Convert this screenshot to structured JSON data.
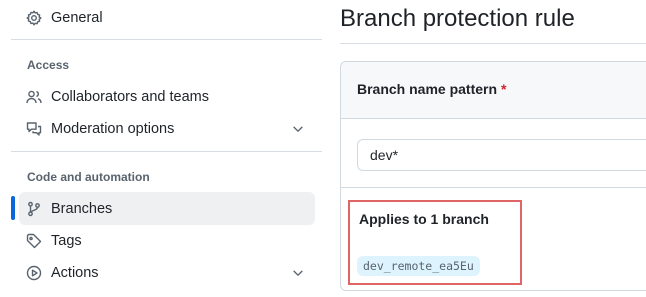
{
  "sidebar": {
    "general_label": "General",
    "access_heading": "Access",
    "collaborators_label": "Collaborators and teams",
    "moderation_label": "Moderation options",
    "code_automation_heading": "Code and automation",
    "branches_label": "Branches",
    "tags_label": "Tags",
    "actions_label": "Actions"
  },
  "main": {
    "title": "Branch protection rule",
    "pattern_label": "Branch name pattern",
    "required_marker": "*",
    "pattern_value": "dev*",
    "applies_label": "Applies to 1 branch",
    "matched_branch": "dev_remote_ea5Eu"
  },
  "colors": {
    "accent": "#0969da",
    "required": "#d1242f",
    "highlight_border": "#e06666",
    "chip_bg": "#ddf4ff"
  },
  "icons": {
    "general": "gear-icon",
    "collaborators": "people-icon",
    "moderation": "comment-discussion-icon",
    "branches": "git-branch-icon",
    "tags": "tag-icon",
    "actions": "play-icon",
    "expand": "chevron-down-icon"
  }
}
